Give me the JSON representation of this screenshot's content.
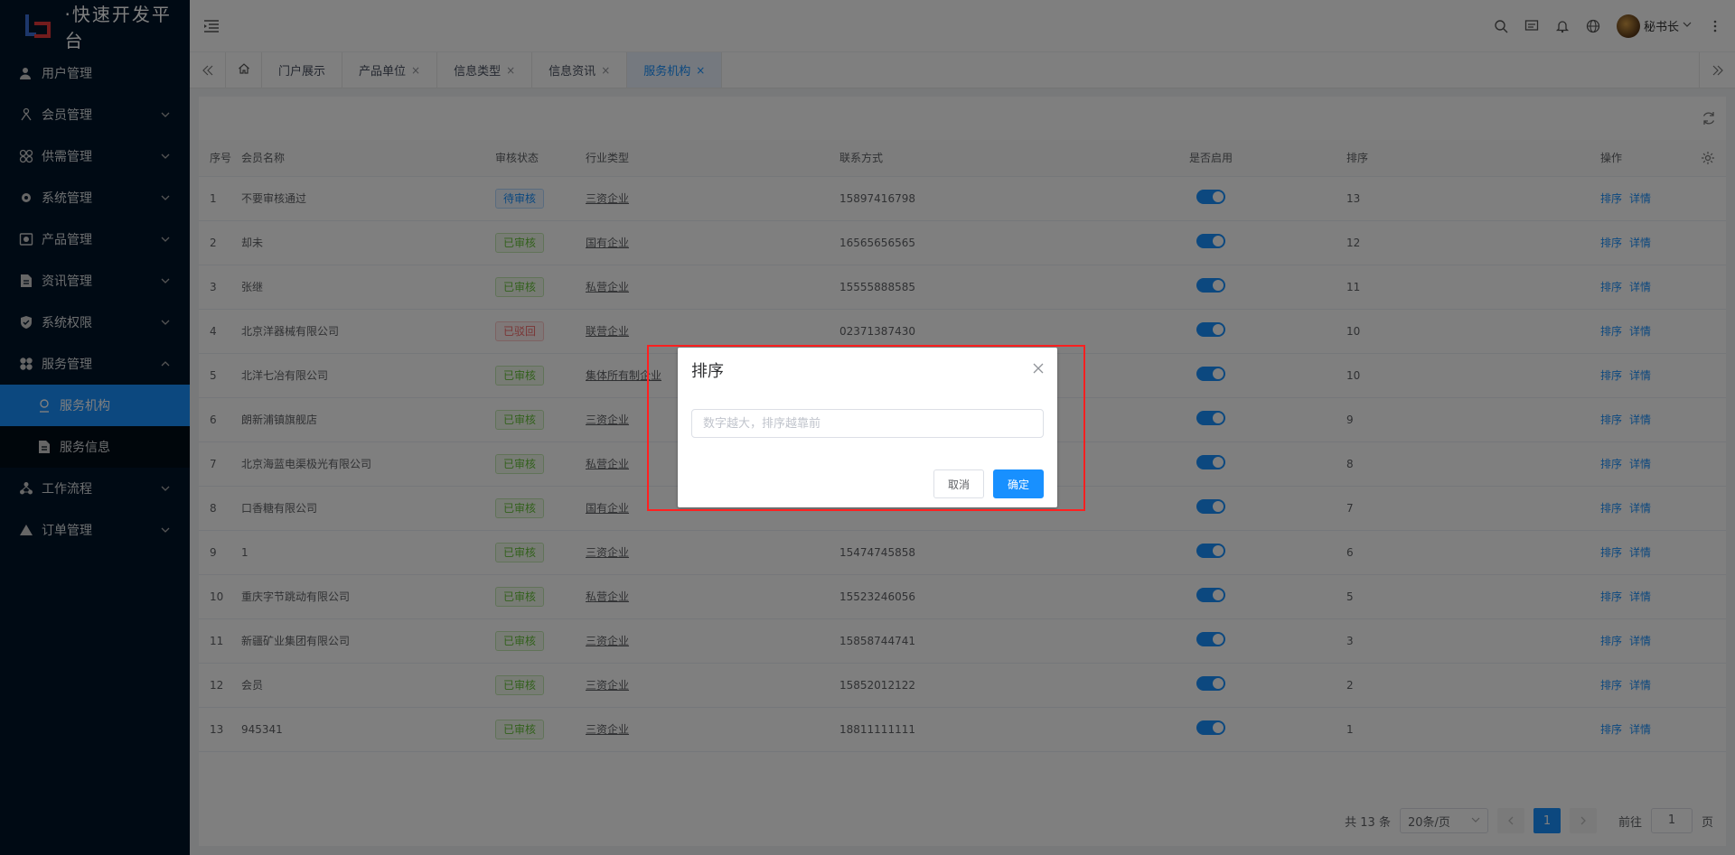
{
  "app": {
    "title": "·快速开发平台"
  },
  "sidebar": {
    "items": [
      {
        "label": "用户管理",
        "icon": "user-icon",
        "expandable": false
      },
      {
        "label": "会员管理",
        "icon": "members-icon",
        "expandable": true
      },
      {
        "label": "供需管理",
        "icon": "supply-icon",
        "expandable": true
      },
      {
        "label": "系统管理",
        "icon": "gear-icon",
        "expandable": true
      },
      {
        "label": "产品管理",
        "icon": "product-icon",
        "expandable": true
      },
      {
        "label": "资讯管理",
        "icon": "document-icon",
        "expandable": true
      },
      {
        "label": "系统权限",
        "icon": "shield-icon",
        "expandable": true
      },
      {
        "label": "服务管理",
        "icon": "service-icon",
        "expandable": true,
        "expanded": true
      },
      {
        "label": "工作流程",
        "icon": "workflow-icon",
        "expandable": true
      },
      {
        "label": "订单管理",
        "icon": "triangle-icon",
        "expandable": true
      }
    ],
    "subitems": [
      {
        "label": "服务机构",
        "active": true
      },
      {
        "label": "服务信息",
        "active": false
      }
    ]
  },
  "header": {
    "user_name": "秘书长"
  },
  "tabs": [
    {
      "label": "门户展示",
      "closable": false
    },
    {
      "label": "产品单位",
      "closable": true
    },
    {
      "label": "信息类型",
      "closable": true
    },
    {
      "label": "信息资讯",
      "closable": true
    },
    {
      "label": "服务机构",
      "closable": true,
      "active": true
    }
  ],
  "tab_close_glyph": "×",
  "table": {
    "columns": [
      "序号",
      "会员名称",
      "审核状态",
      "行业类型",
      "联系方式",
      "是否启用",
      "排序",
      "操作"
    ],
    "rows": [
      {
        "no": "1",
        "name": "不要审核通过",
        "status": "待审核",
        "status_type": "pending",
        "industry": "三资企业",
        "contact": "15897416798",
        "enabled": true,
        "sort": "13"
      },
      {
        "no": "2",
        "name": "却未",
        "status": "已审核",
        "status_type": "ok",
        "industry": "国有企业",
        "contact": "16565656565",
        "enabled": true,
        "sort": "12"
      },
      {
        "no": "3",
        "name": "张继",
        "status": "已审核",
        "status_type": "ok",
        "industry": "私营企业",
        "contact": "15555888585",
        "enabled": true,
        "sort": "11"
      },
      {
        "no": "4",
        "name": "北京洋器械有限公司",
        "status": "已驳回",
        "status_type": "rej",
        "industry": "联营企业",
        "contact": "02371387430",
        "enabled": true,
        "sort": "10"
      },
      {
        "no": "5",
        "name": "北洋七冶有限公司",
        "status": "已审核",
        "status_type": "ok",
        "industry": "集体所有制企业",
        "contact": "",
        "enabled": true,
        "sort": "10"
      },
      {
        "no": "6",
        "name": "朗新浦镇旗舰店",
        "status": "已审核",
        "status_type": "ok",
        "industry": "三资企业",
        "contact": "",
        "enabled": true,
        "sort": "9"
      },
      {
        "no": "7",
        "name": "北京海蓝电渠极光有限公司",
        "status": "已审核",
        "status_type": "ok",
        "industry": "私营企业",
        "contact": "",
        "enabled": true,
        "sort": "8"
      },
      {
        "no": "8",
        "name": "口香糖有限公司",
        "status": "已审核",
        "status_type": "ok",
        "industry": "国有企业",
        "contact": "",
        "enabled": true,
        "sort": "7"
      },
      {
        "no": "9",
        "name": "1",
        "status": "已审核",
        "status_type": "ok",
        "industry": "三资企业",
        "contact": "15474745858",
        "enabled": true,
        "sort": "6"
      },
      {
        "no": "10",
        "name": "重庆字节跳动有限公司",
        "status": "已审核",
        "status_type": "ok",
        "industry": "私营企业",
        "contact": "15523246056",
        "enabled": true,
        "sort": "5"
      },
      {
        "no": "11",
        "name": "新疆矿业集团有限公司",
        "status": "已审核",
        "status_type": "ok",
        "industry": "三资企业",
        "contact": "15858744741",
        "enabled": true,
        "sort": "3"
      },
      {
        "no": "12",
        "name": "会员",
        "status": "已审核",
        "status_type": "ok",
        "industry": "三资企业",
        "contact": "15852012122",
        "enabled": true,
        "sort": "2"
      },
      {
        "no": "13",
        "name": "945341",
        "status": "已审核",
        "status_type": "ok",
        "industry": "三资企业",
        "contact": "18811111111",
        "enabled": true,
        "sort": "1"
      }
    ],
    "actions": [
      "排序",
      "详情"
    ]
  },
  "pagination": {
    "total": "共 13 条",
    "page_size": "20条/页",
    "current_page": "1",
    "goto_prefix": "前往",
    "goto_value": "1",
    "goto_suffix": "页"
  },
  "dialog": {
    "title": "排序",
    "input_placeholder": "数字越大，排序越靠前",
    "input_value": "",
    "cancel_label": "取消",
    "ok_label": "确定"
  },
  "colors": {
    "sidebar_bg": "#001529",
    "accent": "#1890ff",
    "success": "#67c23a",
    "danger": "#f56c6c",
    "highlight": "#ff2020"
  }
}
